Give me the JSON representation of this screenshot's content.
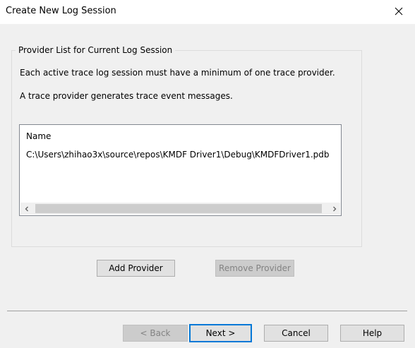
{
  "window": {
    "title": "Create New Log Session"
  },
  "group": {
    "legend": "Provider List for Current Log Session",
    "line1": "Each active trace log session must have a minimum of one trace provider.",
    "line2": "A trace provider generates trace event messages."
  },
  "provider_list": {
    "column_header": "Name",
    "rows": [
      "C:\\Users\\zhihao3x\\source\\repos\\KMDF Driver1\\Debug\\KMDFDriver1.pdb"
    ]
  },
  "buttons": {
    "add_provider": "Add Provider",
    "remove_provider": "Remove Provider",
    "back": "< Back",
    "next": "Next >",
    "cancel": "Cancel",
    "help": "Help"
  },
  "icons": {
    "close": "close-icon",
    "scroll_left": "chevron-left-icon",
    "scroll_right": "chevron-right-icon"
  },
  "colors": {
    "accent": "#0078d7",
    "dialog_bg": "#f0f0f0"
  }
}
